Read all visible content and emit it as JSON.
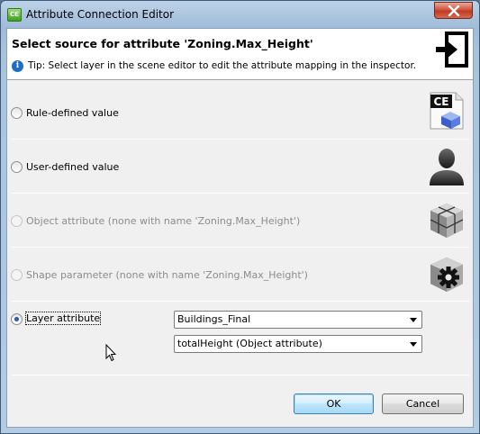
{
  "window": {
    "title": "Attribute Connection Editor",
    "app_icon_text": "CE"
  },
  "header": {
    "title": "Select source for attribute 'Zoning.Max_Height'",
    "tip_icon": "info-icon",
    "tip": "Tip: Select layer in the scene editor to edit the attribute mapping in the inspector."
  },
  "options": [
    {
      "label": "Rule-defined value",
      "checked": false,
      "enabled": true,
      "icon": "ce-rule-icon",
      "icon_text": "CE"
    },
    {
      "label": "User-defined value",
      "checked": false,
      "enabled": true,
      "icon": "user-silhouette-icon"
    },
    {
      "label": "Object attribute (none with name 'Zoning.Max_Height')",
      "checked": false,
      "enabled": false,
      "icon": "object-cubes-icon"
    },
    {
      "label": "Shape parameter (none with name 'Zoning.Max_Height')",
      "checked": false,
      "enabled": false,
      "icon": "shape-gear-icon"
    },
    {
      "label": "Layer attribute",
      "checked": true,
      "enabled": true
    }
  ],
  "layer_select": {
    "value": "Buildings_Final"
  },
  "attribute_select": {
    "value": "totalHeight (Object attribute)"
  },
  "buttons": {
    "ok": "OK",
    "cancel": "Cancel"
  },
  "colors": {
    "accent_blue": "#1c6dc9",
    "close_red": "#c03a22",
    "disabled_text": "#8c8c8c"
  }
}
